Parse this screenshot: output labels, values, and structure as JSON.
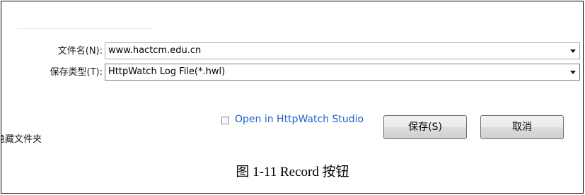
{
  "dialog": {
    "filename_label": "文件名(N):",
    "filename_value": "www.hactcm.edu.cn",
    "filetype_label": "保存类型(T):",
    "filetype_value": "HttpWatch Log File(*.hwl)",
    "hide_folders_label": "隐藏文件夹",
    "open_in_studio_label": "Open in HttpWatch Studio",
    "open_in_studio_checked": false,
    "save_button_label": "保存(S)",
    "cancel_button_label": "取消",
    "dropdown_icon": "chevron-down-icon",
    "colors": {
      "link_text": "#1e63c8",
      "button_border": "#707070",
      "field_border": "#abadb3"
    }
  },
  "caption": "图 1-11 Record 按钮"
}
